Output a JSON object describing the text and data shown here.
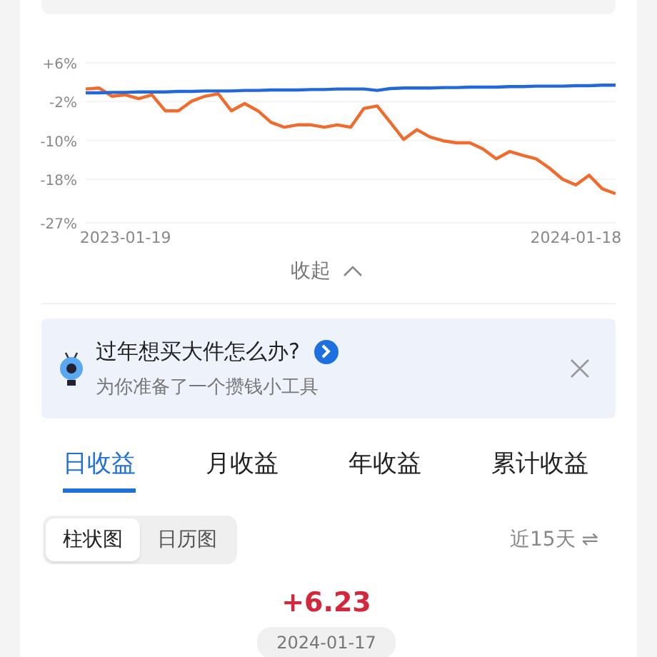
{
  "chart": {
    "chart_data": {
      "type": "line",
      "categories": [
        null,
        null,
        null,
        "2023-01-19",
        null,
        null,
        null,
        null,
        null,
        null,
        null,
        null,
        null,
        null,
        null,
        null,
        null,
        null,
        null,
        null,
        null,
        null,
        null,
        null,
        null,
        null,
        null,
        null,
        null,
        null,
        null,
        null,
        null,
        null,
        null,
        null,
        null,
        "2024-01-18",
        null,
        null,
        null
      ],
      "grid": true,
      "yticks": [
        {
          "value": 6,
          "label": "+6%"
        },
        {
          "value": -2,
          "label": "-2%"
        },
        {
          "value": -10,
          "label": "-10%"
        },
        {
          "value": -18,
          "label": "-18%"
        },
        {
          "value": -27,
          "label": "-27%"
        }
      ],
      "ylim": [
        -27,
        6
      ],
      "series": [
        {
          "color": "#ef6c2e",
          "values": [
            0.6,
            0.8,
            -0.9,
            -0.6,
            -1.4,
            -0.6,
            -3.9,
            -3.9,
            -1.9,
            -0.9,
            -0.4,
            -3.9,
            -2.4,
            -3.9,
            -6.3,
            -7.3,
            -6.8,
            -6.8,
            -7.3,
            -6.8,
            -7.3,
            -3.4,
            -2.9,
            -6.3,
            -9.8,
            -7.8,
            -9.3,
            -10.1,
            -10.5,
            -10.5,
            -11.8,
            -13.8,
            -12.3,
            -13.1,
            -13.8,
            -15.7,
            -18.0,
            -19.2,
            -17.2,
            -20.0,
            -21.0
          ]
        },
        {
          "color": "#2368d9",
          "values": [
            -0.2,
            -0.2,
            -0.1,
            -0.1,
            0,
            0,
            0,
            0.1,
            0.1,
            0.2,
            0.2,
            0.2,
            0.3,
            0.3,
            0.4,
            0.4,
            0.4,
            0.5,
            0.5,
            0.6,
            0.6,
            0.6,
            0.3,
            0.7,
            0.8,
            0.8,
            0.8,
            0.9,
            0.9,
            1.0,
            1.0,
            1.0,
            1.1,
            1.1,
            1.2,
            1.2,
            1.2,
            1.3,
            1.3,
            1.4,
            1.4
          ]
        }
      ]
    },
    "collapse": {
      "label": "收起"
    }
  },
  "banner": {
    "title": "过年想买大件怎么办?",
    "subtitle": "为你准备了一个攒钱小工具"
  },
  "tabs": [
    {
      "label": "日收益",
      "selected": true
    },
    {
      "label": "月收益",
      "selected": false
    },
    {
      "label": "年收益",
      "selected": false
    },
    {
      "label": "累计收益",
      "selected": false
    }
  ],
  "view_toggle": [
    {
      "label": "柱状图",
      "selected": true
    },
    {
      "label": "日历图",
      "selected": false
    }
  ],
  "range": {
    "label": "近15天",
    "icon": "⇌"
  },
  "value": "+6.23",
  "date": "2024-01-17"
}
